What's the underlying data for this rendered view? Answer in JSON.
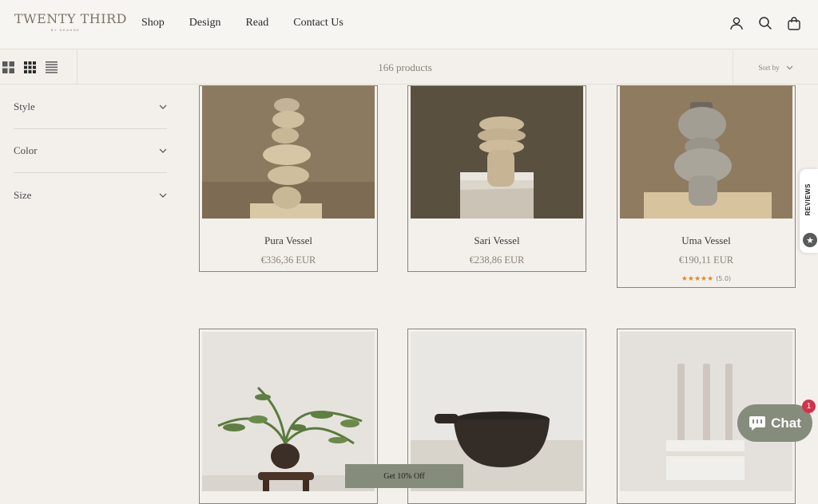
{
  "brand": {
    "name": "Twenty Third",
    "tagline": "BY DEANNE"
  },
  "nav": {
    "items": [
      "Shop",
      "Design",
      "Read",
      "Contact Us"
    ]
  },
  "header_icons": [
    "account-icon",
    "search-icon",
    "bag-icon"
  ],
  "toolbar": {
    "count": "166 products",
    "sort_label": "Sort by"
  },
  "filters": [
    "Style",
    "Color",
    "Size"
  ],
  "products": [
    {
      "title": "Pura Vessel",
      "price": "€336,36 EUR"
    },
    {
      "title": "Sari Vessel",
      "price": "€238,86 EUR"
    },
    {
      "title": "Uma Vessel",
      "price": "€190,11 EUR",
      "stars": "★★★★★",
      "rating": "(5.0)"
    },
    {
      "title": "",
      "price": ""
    },
    {
      "title": "",
      "price": ""
    },
    {
      "title": "",
      "price": ""
    }
  ],
  "reviews_tab": {
    "label": "REVIEWS"
  },
  "chat": {
    "label": "Chat",
    "badge": "1"
  },
  "promo": {
    "label": "Get 10% Off"
  },
  "colors": {
    "background": "#f3f0ec",
    "accent": "#858c7b",
    "star": "#e08a1e",
    "badge": "#d1344a"
  }
}
